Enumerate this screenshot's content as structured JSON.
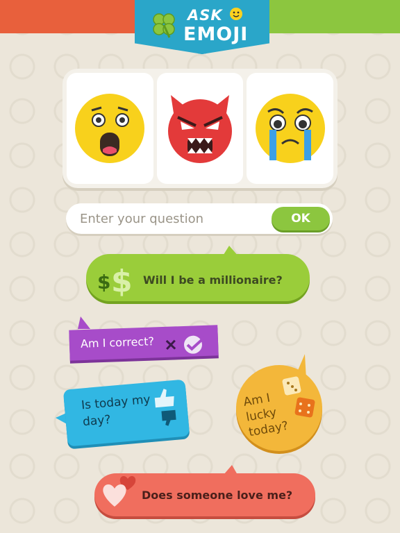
{
  "header": {
    "logo_top": "ASK",
    "logo_bottom": "EMOJI"
  },
  "emoji_slots": [
    {
      "icon": "shocked-face-icon"
    },
    {
      "icon": "angry-devil-icon"
    },
    {
      "icon": "crying-face-icon"
    }
  ],
  "question": {
    "placeholder": "Enter your question",
    "value": "",
    "ok_label": "OK"
  },
  "suggestions": [
    {
      "label": "Will I be a millionaire?",
      "icon": "dollar-icon",
      "color": "#9acd3a"
    },
    {
      "label": "Am I correct?",
      "icon": "check-cross-icon",
      "color": "#a74cc9"
    },
    {
      "label": "Is today my day?",
      "icon": "thumbs-icon",
      "color": "#31b7e3"
    },
    {
      "label": "Am I lucky today?",
      "icon": "dice-icon",
      "color": "#f3b73a"
    },
    {
      "label": "Does someone love me?",
      "icon": "hearts-icon",
      "color": "#f06e5e"
    }
  ]
}
